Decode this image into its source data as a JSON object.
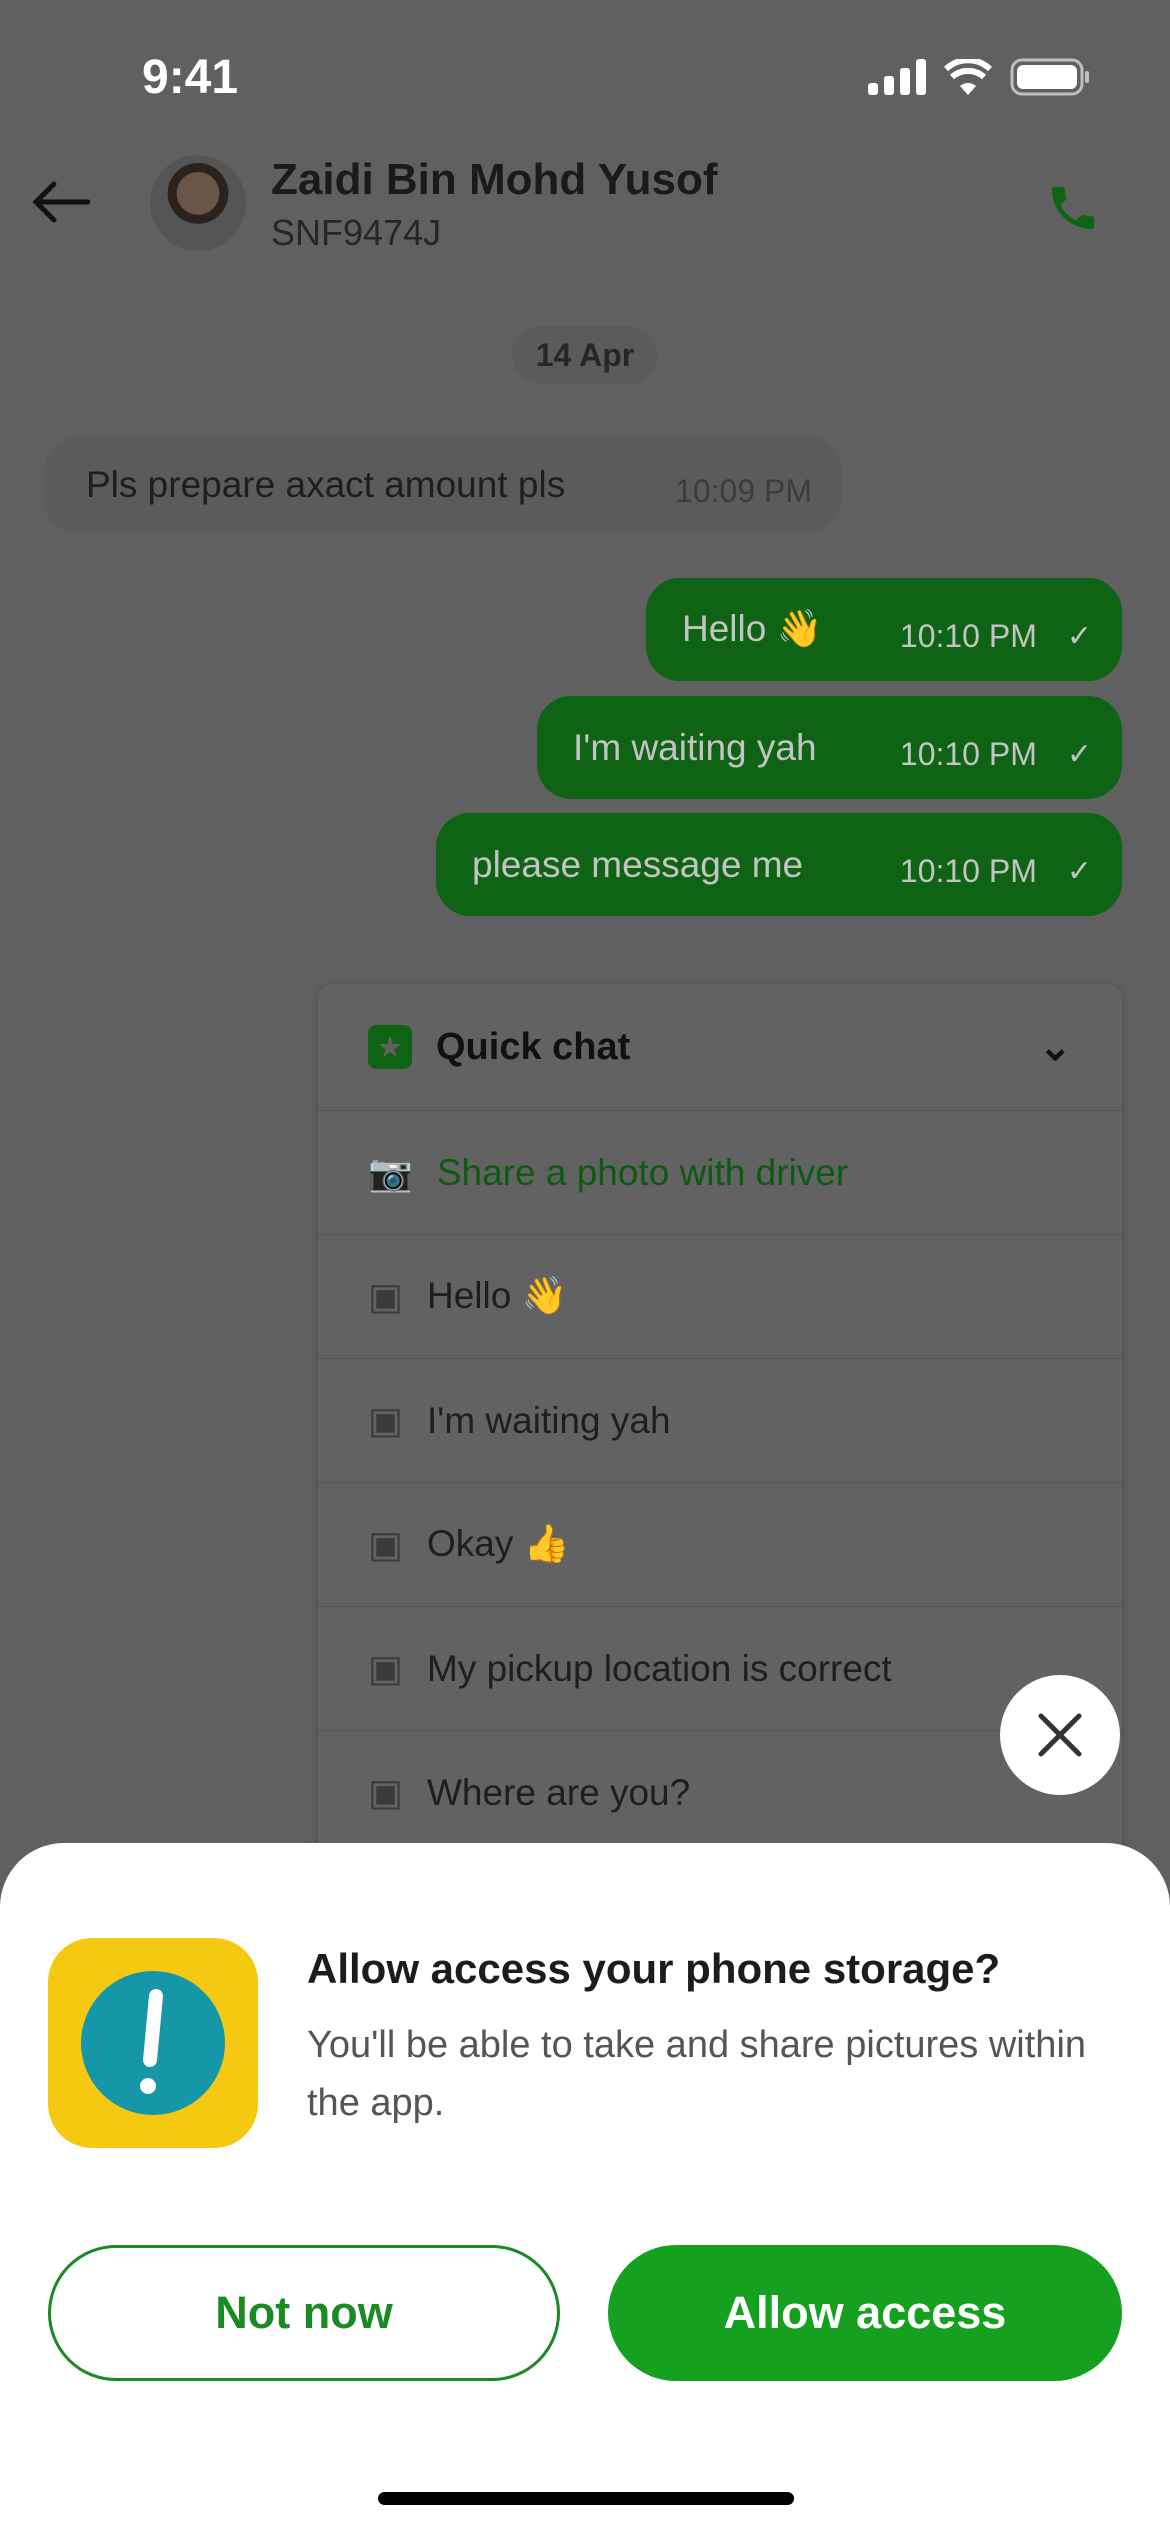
{
  "status_bar": {
    "time": "9:41"
  },
  "header": {
    "name": "Zaidi Bin Mohd Yusof",
    "plate": "SNF9474J"
  },
  "chat": {
    "date": "14 Apr",
    "messages": [
      {
        "text": "Pls prepare axact amount pls",
        "time": "10:09 PM",
        "direction": "in"
      },
      {
        "text": "Hello 👋",
        "time": "10:10 PM",
        "direction": "out"
      },
      {
        "text": "I'm waiting yah",
        "time": "10:10 PM",
        "direction": "out"
      },
      {
        "text": "please message me",
        "time": "10:10 PM",
        "direction": "out"
      }
    ]
  },
  "quick_chat": {
    "title": "Quick chat",
    "share_photo": "Share a photo with driver",
    "items": [
      "Hello 👋",
      "I'm waiting yah",
      "Okay 👍",
      "My pickup location is correct",
      "Where are you?"
    ]
  },
  "dialog": {
    "title": "Allow access your phone storage?",
    "description": "You'll be able to take and share pictures within the app.",
    "not_now": "Not now",
    "allow": "Allow access"
  },
  "colors": {
    "brand_green": "#16a01f",
    "icon_yellow": "#f5c812",
    "icon_teal": "#1597a8"
  }
}
